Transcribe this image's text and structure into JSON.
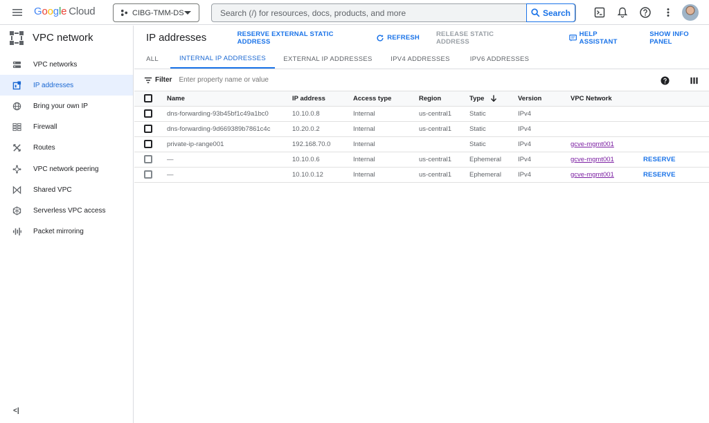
{
  "topbar": {
    "logo_parts": [
      "G",
      "o",
      "o",
      "g",
      "l",
      "e"
    ],
    "logo_cloud": "Cloud",
    "project": "CIBG-TMM-DS",
    "search_placeholder": "Search (/) for resources, docs, products, and more",
    "search_button": "Search",
    "icons": [
      "terminal-icon",
      "bell-icon",
      "help-icon",
      "more-vert-icon"
    ]
  },
  "sidebar": {
    "title": "VPC network",
    "items": [
      {
        "label": "VPC networks",
        "icon": "vpc-networks-icon",
        "active": false
      },
      {
        "label": "IP addresses",
        "icon": "ip-address-icon",
        "active": true
      },
      {
        "label": "Bring your own IP",
        "icon": "globe-icon",
        "active": false
      },
      {
        "label": "Firewall",
        "icon": "firewall-icon",
        "active": false
      },
      {
        "label": "Routes",
        "icon": "routes-icon",
        "active": false
      },
      {
        "label": "VPC network peering",
        "icon": "peering-icon",
        "active": false
      },
      {
        "label": "Shared VPC",
        "icon": "shared-vpc-icon",
        "active": false
      },
      {
        "label": "Serverless VPC access",
        "icon": "serverless-icon",
        "active": false
      },
      {
        "label": "Packet mirroring",
        "icon": "packet-mirroring-icon",
        "active": false
      }
    ],
    "collapse": "<|"
  },
  "header": {
    "title": "IP addresses",
    "reserve_external": "RESERVE EXTERNAL STATIC ADDRESS",
    "refresh": "REFRESH",
    "release_static": "RELEASE STATIC ADDRESS",
    "help_assistant": "HELP ASSISTANT",
    "show_info_panel": "SHOW INFO PANEL"
  },
  "tabs": [
    {
      "label": "ALL",
      "active": false
    },
    {
      "label": "INTERNAL IP ADDRESSES",
      "active": true
    },
    {
      "label": "EXTERNAL IP ADDRESSES",
      "active": false
    },
    {
      "label": "IPV4 ADDRESSES",
      "active": false
    },
    {
      "label": "IPV6 ADDRESSES",
      "active": false
    }
  ],
  "filter": {
    "label": "Filter",
    "placeholder": "Enter property name or value"
  },
  "table": {
    "columns": [
      "Name",
      "IP address",
      "Access type",
      "Region",
      "Type",
      "Version",
      "VPC Network"
    ],
    "sort_column": "Type",
    "rows": [
      {
        "name": "dns-forwarding-93b45bf1c49a1bc0",
        "ip": "10.10.0.8",
        "access": "Internal",
        "region": "us-central1",
        "type": "Static",
        "version": "IPv4",
        "vpc": "",
        "action": ""
      },
      {
        "name": "dns-forwarding-9d669389b7861c4c",
        "ip": "10.20.0.2",
        "access": "Internal",
        "region": "us-central1",
        "type": "Static",
        "version": "IPv4",
        "vpc": "",
        "action": ""
      },
      {
        "name": "private-ip-range001",
        "ip": "192.168.70.0",
        "access": "Internal",
        "region": "",
        "type": "Static",
        "version": "IPv4",
        "vpc": "gcve-mgmt001",
        "action": ""
      },
      {
        "name": "—",
        "ip": "10.10.0.6",
        "access": "Internal",
        "region": "us-central1",
        "type": "Ephemeral",
        "version": "IPv4",
        "vpc": "gcve-mgmt001",
        "action": "RESERVE"
      },
      {
        "name": "—",
        "ip": "10.10.0.12",
        "access": "Internal",
        "region": "us-central1",
        "type": "Ephemeral",
        "version": "IPv4",
        "vpc": "gcve-mgmt001",
        "action": "RESERVE"
      }
    ]
  },
  "colors": {
    "accent": "#1a73e8",
    "active_bg": "#e8f0fe",
    "link_visited": "#7b1fa2",
    "border": "#dadce0"
  }
}
